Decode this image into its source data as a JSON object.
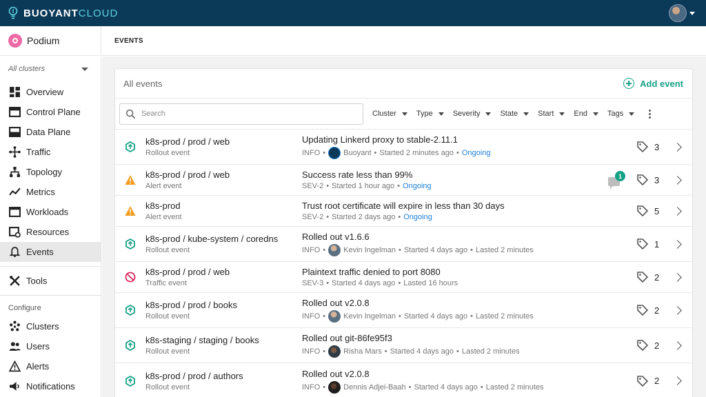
{
  "app": {
    "brand_left": "BUOYANT",
    "brand_right": "CLOUD"
  },
  "sidebar": {
    "org_name": "Podium",
    "cluster_selector": "All clusters",
    "items": [
      {
        "label": "Overview",
        "icon": "overview-icon"
      },
      {
        "label": "Control Plane",
        "icon": "control-plane-icon"
      },
      {
        "label": "Data Plane",
        "icon": "data-plane-icon"
      },
      {
        "label": "Traffic",
        "icon": "traffic-icon"
      },
      {
        "label": "Topology",
        "icon": "topology-icon"
      },
      {
        "label": "Metrics",
        "icon": "metrics-icon"
      },
      {
        "label": "Workloads",
        "icon": "workloads-icon"
      },
      {
        "label": "Resources",
        "icon": "resources-icon"
      },
      {
        "label": "Events",
        "icon": "bell-icon"
      }
    ],
    "tools_label": "Tools",
    "configure_label": "Configure",
    "configure_items": [
      {
        "label": "Clusters"
      },
      {
        "label": "Users"
      },
      {
        "label": "Alerts"
      },
      {
        "label": "Notifications"
      }
    ]
  },
  "page": {
    "title": "EVENTS"
  },
  "card": {
    "title": "All events",
    "add_label": "Add event",
    "search_placeholder": "Search",
    "filters": [
      "Cluster",
      "Type",
      "Severity",
      "State",
      "Start",
      "End",
      "Tags"
    ]
  },
  "events": [
    {
      "target": "k8s-prod / prod / web",
      "type": "Rollout event",
      "title": "Updating Linkerd proxy to stable-2.11.1",
      "severity": "INFO",
      "user": "Buoyant",
      "started": "Started 2 minutes ago",
      "status": "Ongoing",
      "tags": "3"
    },
    {
      "target": "k8s-prod / prod / web",
      "type": "Alert event",
      "title": "Success rate less than 99%",
      "severity": "SEV-2",
      "started": "Started 1 hour ago",
      "status": "Ongoing",
      "tags": "3",
      "comments": "1"
    },
    {
      "target": "k8s-prod",
      "type": "Alert event",
      "title": "Trust root certificate will expire in less than 30 days",
      "severity": "SEV-2",
      "started": "Started 2 days ago",
      "status": "Ongoing",
      "tags": "5"
    },
    {
      "target": "k8s-prod / kube-system / coredns",
      "type": "Rollout event",
      "title": "Rolled out v1.6.6",
      "severity": "INFO",
      "user": "Kevin Ingelman",
      "started": "Started 4 days ago",
      "lasted": "Lasted 2 minutes",
      "tags": "1"
    },
    {
      "target": "k8s-prod / prod / web",
      "type": "Traffic event",
      "title": "Plaintext traffic denied to port 8080",
      "severity": "SEV-3",
      "started": "Started 4 days ago",
      "lasted": "Lasted 16 hours",
      "tags": "2"
    },
    {
      "target": "k8s-prod / prod / books",
      "type": "Rollout event",
      "title": "Rolled out v2.0.8",
      "severity": "INFO",
      "user": "Kevin Ingelman",
      "started": "Started 4 days ago",
      "lasted": "Lasted 2 minutes",
      "tags": "2"
    },
    {
      "target": "k8s-staging / staging / books",
      "type": "Rollout event",
      "title": "Rolled out git-86fe95f3",
      "severity": "INFO",
      "user": "Risha Mars",
      "started": "Started 4 days ago",
      "lasted": "Lasted 2 minutes",
      "tags": "2"
    },
    {
      "target": "k8s-prod / prod / authors",
      "type": "Rollout event",
      "title": "Rolled out v2.0.8",
      "severity": "INFO",
      "user": "Dennis Adjei-Baah",
      "started": "Started 4 days ago",
      "lasted": "Lasted 2 minutes",
      "tags": "2"
    }
  ],
  "colors": {
    "topbar": "#0b3a59",
    "accent": "#14a085",
    "warning": "#f39c1f",
    "denied": "#e0245e",
    "ongoing": "#1f7fd6"
  }
}
